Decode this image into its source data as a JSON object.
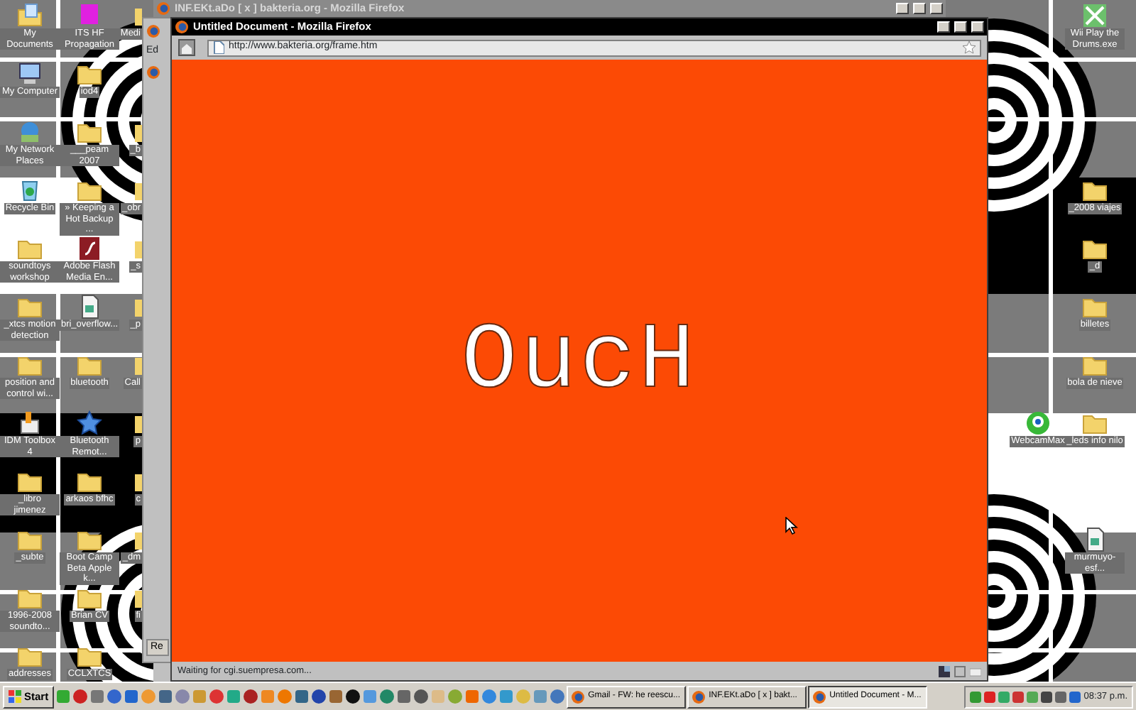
{
  "desktop": {
    "icon_columns": [
      {
        "icons": [
          {
            "label": "My Documents",
            "kind": "documents"
          },
          {
            "label": "My Computer",
            "kind": "computer"
          },
          {
            "label": "My Network Places",
            "kind": "network"
          },
          {
            "label": "Recycle Bin",
            "kind": "recycle"
          },
          {
            "label": "soundtoys workshop",
            "kind": "folder"
          },
          {
            "label": "_xtcs motion detection",
            "kind": "folder"
          },
          {
            "label": "position and control wi...",
            "kind": "folder"
          },
          {
            "label": "IDM Toolbox 4",
            "kind": "tool"
          },
          {
            "label": "_libro jimenez",
            "kind": "folder"
          },
          {
            "label": "_subte",
            "kind": "folder"
          },
          {
            "label": "1996-2008 soundto...",
            "kind": "folder"
          },
          {
            "label": "addresses",
            "kind": "folder"
          }
        ]
      },
      {
        "icons": [
          {
            "label": "ITS HF Propagation",
            "kind": "hf"
          },
          {
            "label": "iod4",
            "kind": "folder"
          },
          {
            "label": "___peam 2007",
            "kind": "folder"
          },
          {
            "label": "» Keeping a Hot Backup ...",
            "kind": "folder"
          },
          {
            "label": "Adobe Flash Media En...",
            "kind": "flash"
          },
          {
            "label": "bri_overflow...",
            "kind": "file"
          },
          {
            "label": "bluetooth",
            "kind": "folder"
          },
          {
            "label": "Bluetooth Remot...",
            "kind": "star"
          },
          {
            "label": "arkaos bfhc",
            "kind": "folder"
          },
          {
            "label": "Boot Camp Beta Apple k...",
            "kind": "folder"
          },
          {
            "label": "Brian CV",
            "kind": "folder"
          },
          {
            "label": "CCLXTCS",
            "kind": "folder"
          }
        ]
      },
      {
        "icons": [
          {
            "label": "Medi",
            "kind": "partial"
          },
          {
            "kind": "empty"
          },
          {
            "label": "_b",
            "kind": "partial"
          },
          {
            "label": "_obr",
            "kind": "partial"
          },
          {
            "label": "_s",
            "kind": "partial"
          },
          {
            "label": "_p",
            "kind": "partial"
          },
          {
            "label": "Call",
            "kind": "partial"
          },
          {
            "label": "p",
            "kind": "partial"
          },
          {
            "label": "c",
            "kind": "partial"
          },
          {
            "label": "_dm",
            "kind": "partial"
          },
          {
            "label": "fi",
            "kind": "partial"
          }
        ]
      },
      {
        "icons": [
          {
            "kind": "empty"
          },
          {
            "kind": "empty"
          },
          {
            "kind": "empty"
          },
          {
            "kind": "empty"
          },
          {
            "kind": "empty"
          },
          {
            "kind": "empty"
          },
          {
            "kind": "empty"
          },
          {
            "label": "WebcamMax",
            "kind": "webcam"
          }
        ]
      },
      {
        "icons": [
          {
            "label": "Wii Play the Drums.exe",
            "kind": "wii"
          },
          {
            "kind": "empty"
          },
          {
            "kind": "empty"
          },
          {
            "label": "_2008 viajes",
            "kind": "folder"
          },
          {
            "label": "_d",
            "kind": "folder"
          },
          {
            "label": "billetes",
            "kind": "folder"
          },
          {
            "label": "bola de nieve",
            "kind": "folder"
          },
          {
            "label": "_leds info nilo",
            "kind": "folder"
          },
          {
            "kind": "empty"
          },
          {
            "label": "murmuyo-esf...",
            "kind": "file"
          }
        ]
      }
    ]
  },
  "back_windows": [
    {
      "title": "INF.EKt.aDo [ x ] bakteria.org - Mozilla Firefox",
      "active": false
    },
    {
      "menu": "Ed",
      "button": "Re"
    }
  ],
  "window": {
    "title": "Untitled Document - Mozilla Firefox",
    "active": true,
    "address": "http://www.bakteria.org/frame.htm",
    "page_text": "OucH",
    "status": "Waiting for cgi.suempresa.com..."
  },
  "taskbar": {
    "start": "Start",
    "tasks": [
      {
        "label": "Gmail - FW: he reescu...",
        "selected": false
      },
      {
        "label": "INF.EKt.aDo [ x ] bakt...",
        "selected": false
      },
      {
        "label": "Untitled Document - M...",
        "selected": true
      }
    ],
    "clock": "08:37 p.m."
  }
}
